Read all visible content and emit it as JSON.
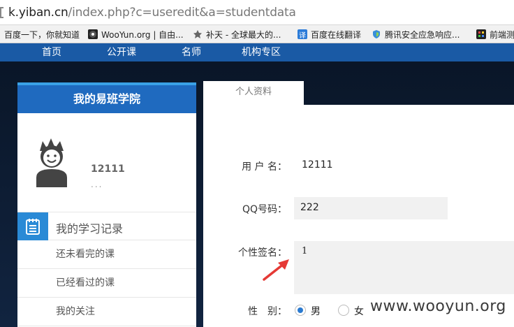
{
  "browser": {
    "url_host": "k.yiban.cn",
    "url_path": "/index.php?c=useredit&a=studentdata",
    "bookmarks": [
      {
        "label": "百度一下，你就知道",
        "icon": "baidu-icon"
      },
      {
        "label": "WooYun.org | 自由...",
        "icon": "wooyun-icon"
      },
      {
        "label": "补天 - 全球最大的...",
        "icon": "butian-icon"
      },
      {
        "label": "百度在线翻译",
        "icon": "translate-icon"
      },
      {
        "label": "腾讯安全应急响应...",
        "icon": "tencent-shield-icon"
      },
      {
        "label": "前端测",
        "icon": "bookmark-icon"
      }
    ]
  },
  "nav": {
    "items": [
      "首页",
      "公开课",
      "名师",
      "机构专区"
    ]
  },
  "sidebar": {
    "title": "我的易班学院",
    "username": "12111",
    "username_sub": "...",
    "menu_title": "我的学习记录",
    "items": [
      "还未看完的课",
      "已经看过的课",
      "我的关注"
    ]
  },
  "profile_tab": "个人资料",
  "form": {
    "username_label": "用 户 名：",
    "username_value": "12111",
    "qq_label": "QQ号码：",
    "qq_value": "222",
    "signature_label": "个性签名：",
    "signature_value": "1",
    "gender_label": "性　别：",
    "gender_male": "男",
    "gender_female": "女",
    "gender_selected": "男"
  },
  "watermark": "www.wooyun.org",
  "colors": {
    "nav_blue": "#1a5aa5",
    "sidebar_header": "#1f6abf",
    "menu_icon_bg": "#2a8ad6",
    "arrow_red": "#e53935"
  }
}
